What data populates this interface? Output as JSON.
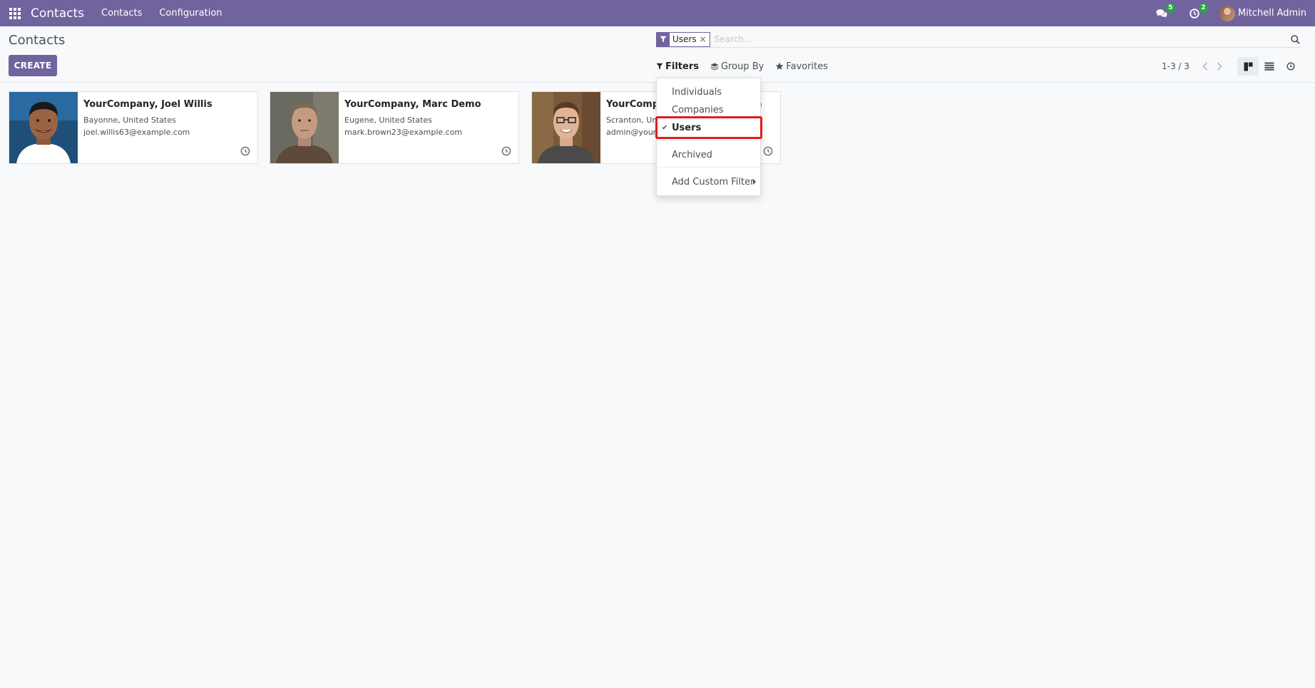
{
  "navbar": {
    "brand": "Contacts",
    "menu": [
      "Contacts",
      "Configuration"
    ],
    "messages_count": "5",
    "activities_count": "2",
    "user_name": "Mitchell Admin"
  },
  "control_panel": {
    "title": "Contacts",
    "create_label": "CREATE",
    "search": {
      "facet_value": "Users",
      "facet_remove": "×",
      "placeholder": "Search..."
    },
    "filters_label": "Filters",
    "group_by_label": "Group By",
    "favorites_label": "Favorites",
    "pager": "1-3 / 3"
  },
  "filter_dropdown": {
    "items": [
      "Individuals",
      "Companies",
      "Users",
      "Archived",
      "Add Custom Filter"
    ],
    "checked": "Users"
  },
  "cards": [
    {
      "name": "YourCompany, Joel Willis",
      "line1": "Bayonne, United States",
      "line2": "joel.willis63@example.com"
    },
    {
      "name": "YourCompany, Marc Demo",
      "line1": "Eugene, United States",
      "line2": "mark.brown23@example.com"
    },
    {
      "name": "YourCompany, Mitchell Admin",
      "line1": "Scranton, United States",
      "line2": "admin@yourcompany.example.com"
    }
  ],
  "colors": {
    "primary": "#71639e",
    "badge": "#28a745",
    "highlight": "#e41b1b"
  }
}
